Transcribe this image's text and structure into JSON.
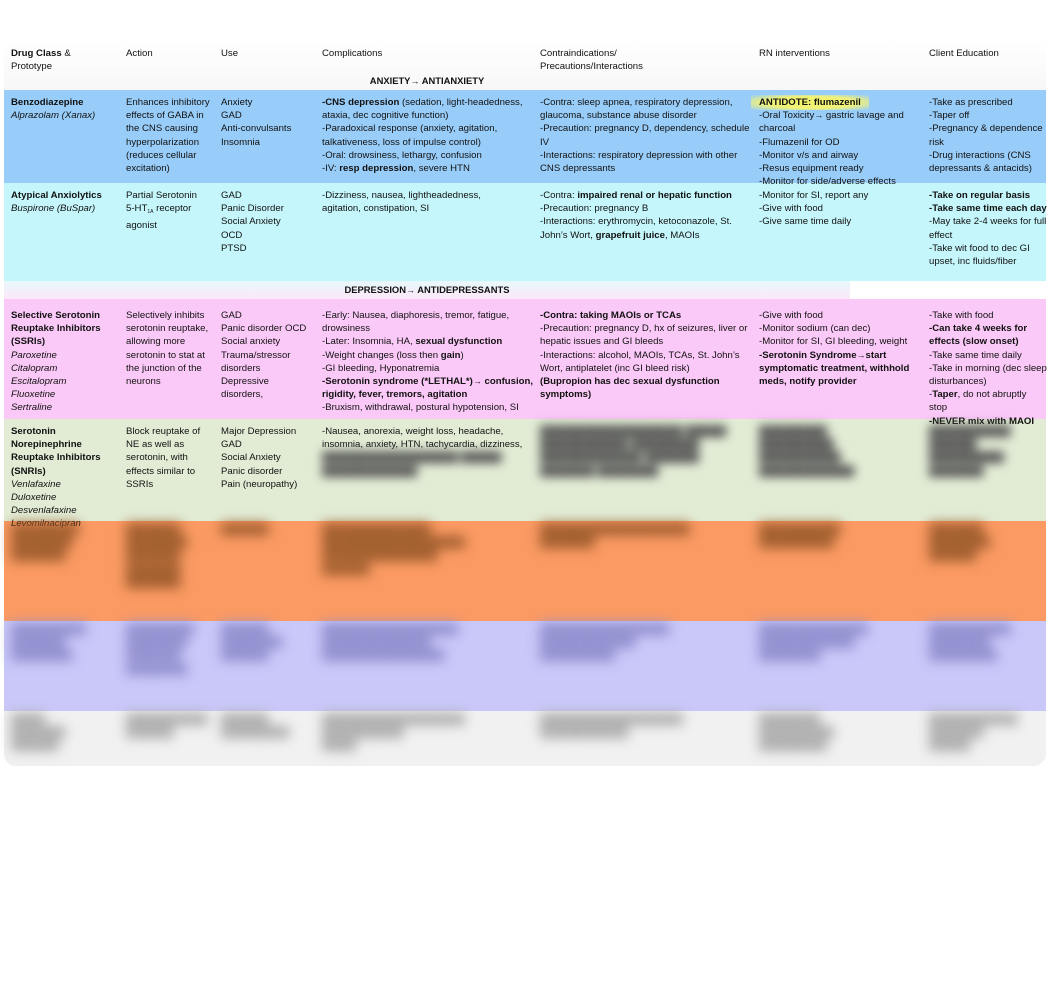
{
  "headers": {
    "drug_class_bold": "Drug Class",
    "drug_class_rest": " &",
    "drug_class_line2": "Prototype",
    "action": "Action",
    "use": "Use",
    "complications": "Complications",
    "contra_line1": "Contraindications/",
    "contra_line2": "Precautions/Interactions",
    "rn": "RN interventions",
    "education": "Client Education"
  },
  "sections": {
    "anxiety": {
      "left": "ANXIETY",
      "arrow": "→",
      "right": " ANTIANXIETY"
    },
    "depression": {
      "left": "DEPRESSION",
      "arrow": "→",
      "right": " ANTIDEPRESSANTS"
    }
  },
  "rows": {
    "benzo": {
      "class": "Benzodiazepine",
      "prototype": "Alprazolam (Xanax)",
      "action": "Enhances inhibitory effects of GABA in the CNS causing hyperpolarization (reduces cellular excitation)",
      "use": [
        "Anxiety",
        "GAD",
        "Anti-convulsants",
        "Insomnia"
      ],
      "complications": {
        "c1_bold": "-CNS depression",
        "c1_rest": " (sedation, light-headedness, ataxia, dec cognitive function)",
        "c2": "-Paradoxical response (anxiety, agitation, talkativeness, loss of impulse control)",
        "c3": "-Oral: drowsiness, lethargy, confusion",
        "c4_pre": "-IV:  ",
        "c4_bold": "resp depression",
        "c4_rest": ", severe HTN"
      },
      "contra": [
        "-Contra: sleep apnea, respiratory depression, glaucoma, substance abuse disorder",
        "-Precaution: pregnancy D, dependency, schedule IV",
        "-Interactions: respiratory depression with other CNS depressants"
      ],
      "rn": {
        "antidote": "ANTIDOTE: flumazenil",
        "r1_pre": "-Oral Toxicity",
        "r1_arrow": "→",
        "r1_rest": " gastric lavage and charcoal",
        "r2": "-Flumazenil for OD",
        "r3": "-Monitor v/s and airway",
        "r4": "-Resus equipment ready",
        "r5": "-Monitor for side/adverse effects"
      },
      "education": [
        "-Take as prescribed",
        "-Taper off",
        "-Pregnancy & dependence risk",
        "-Drug interactions (CNS depressants & antacids)"
      ]
    },
    "atypical": {
      "class": "Atypical Anxiolytics",
      "prototype": "Buspirone (BuSpar)",
      "action_l1": "Partial Serotonin",
      "action_l2_pre": "5-HT",
      "action_l2_sub": "1A",
      "action_l2_rest": " receptor agonist",
      "use": [
        "GAD",
        "Panic Disorder",
        "Social Anxiety",
        "OCD",
        "PTSD"
      ],
      "complications": "-Dizziness, nausea, lightheadedness, agitation, constipation, SI",
      "contra": {
        "c1_pre": "-Contra: ",
        "c1_bold": "impaired renal or hepatic function",
        "c2": "-Precaution: pregnancy B",
        "c3_pre": "-Interactions: erythromycin, ketoconazole, St. John’s Wort, ",
        "c3_bold": "grapefruit juice",
        "c3_rest": ", MAOIs"
      },
      "rn": [
        "-Monitor for SI, report any",
        "-Give with food",
        "-Give same time daily"
      ],
      "education": {
        "e1": "-Take on regular basis",
        "e2": "-Take same time each day",
        "e3": "-May take 2-4 weeks for full effect",
        "e4": "-Take wit food to dec GI upset, inc fluids/fiber"
      }
    },
    "ssri": {
      "class": "Selective Serotonin Reuptake Inhibitors (SSRIs)",
      "prototypes": [
        "Paroxetine",
        "Citalopram",
        "Escitalopram",
        "Fluoxetine",
        "Sertraline"
      ],
      "action": "Selectively inhibits serotonin reuptake, allowing more serotonin to stat at the junction of the neurons",
      "use": [
        "GAD",
        "Panic disorder OCD",
        "Social anxiety",
        "Trauma/stressor disorders",
        "Depressive disorders,"
      ],
      "complications": {
        "c1": "-Early: Nausea, diaphoresis, tremor, fatigue, drowsiness",
        "c2_pre": "-Later: Insomnia, HA, ",
        "c2_bold": "sexual dysfunction",
        "c3_pre": "-Weight changes (loss then ",
        "c3_bold": "gain",
        "c3_rest": ")",
        "c4": "-GI bleeding, Hyponatremia",
        "c5_bold": "-Serotonin syndrome (*LETHAL*)",
        "c5_arrow": "→",
        "c5_bold2": " confusion, rigidity, fever, tremors, agitation",
        "c6": "-Bruxism, withdrawal, postural hypotension, SI"
      },
      "contra": {
        "c1_bold": "-Contra: taking MAOIs or TCAs",
        "c2": "-Precaution: pregnancy D, hx of seizures, liver or hepatic issues and GI bleeds",
        "c3": "-Interactions: alcohol, MAOIs, TCAs, St. John’s Wort, antiplatelet (inc GI bleed risk)",
        "c4_bold": "(Bupropion has dec sexual dysfunction symptoms)"
      },
      "rn": {
        "r1": "-Give with food",
        "r2": "-Monitor sodium (can dec)",
        "r3": "-Monitor for SI, GI bleeding, weight",
        "r4_bold": "-Serotonin Syndrome",
        "r4_arrow": "→",
        "r4_bold2": "start symptomatic treatment, withhold meds, notify provider"
      },
      "education": {
        "e1": "-Take with food",
        "e2_bold": "-Can take 4 weeks for effects (slow onset)",
        "e3": "-Take same time daily",
        "e4": "-Take in morning (dec sleep disturbances)",
        "e5_pre": "-",
        "e5_bold": "Taper",
        "e5_rest": ", do not abruptly stop",
        "e6_bold": "-NEVER mix with MAOI"
      }
    },
    "snri": {
      "class": "Serotonin Norepinephrine Reuptake Inhibitors (SNRIs)",
      "prototypes": [
        "Venlafaxine",
        "Duloxetine",
        "Desvenlafaxine",
        "Levomilnacipran"
      ],
      "action": "Block reuptake of NE as well as serotonin, with effects similar to SSRIs",
      "use": [
        "Major Depression",
        "GAD",
        "Social Anxiety",
        "Panic disorder",
        "Pain (neuropathy)"
      ],
      "complications": "-Nausea, anorexia, weight loss, headache, insomnia, anxiety, HTN, tachycardia, dizziness,"
    }
  },
  "colors": {
    "benzo": "#99cdf9",
    "atypical": "#c5f6fb",
    "ssri": "#fbc9f8",
    "snri": "#e2ecd5",
    "tca_blurred": "#fb9a63",
    "maoi_blurred": "#c9c8f9",
    "highlight": "#f0f279"
  }
}
